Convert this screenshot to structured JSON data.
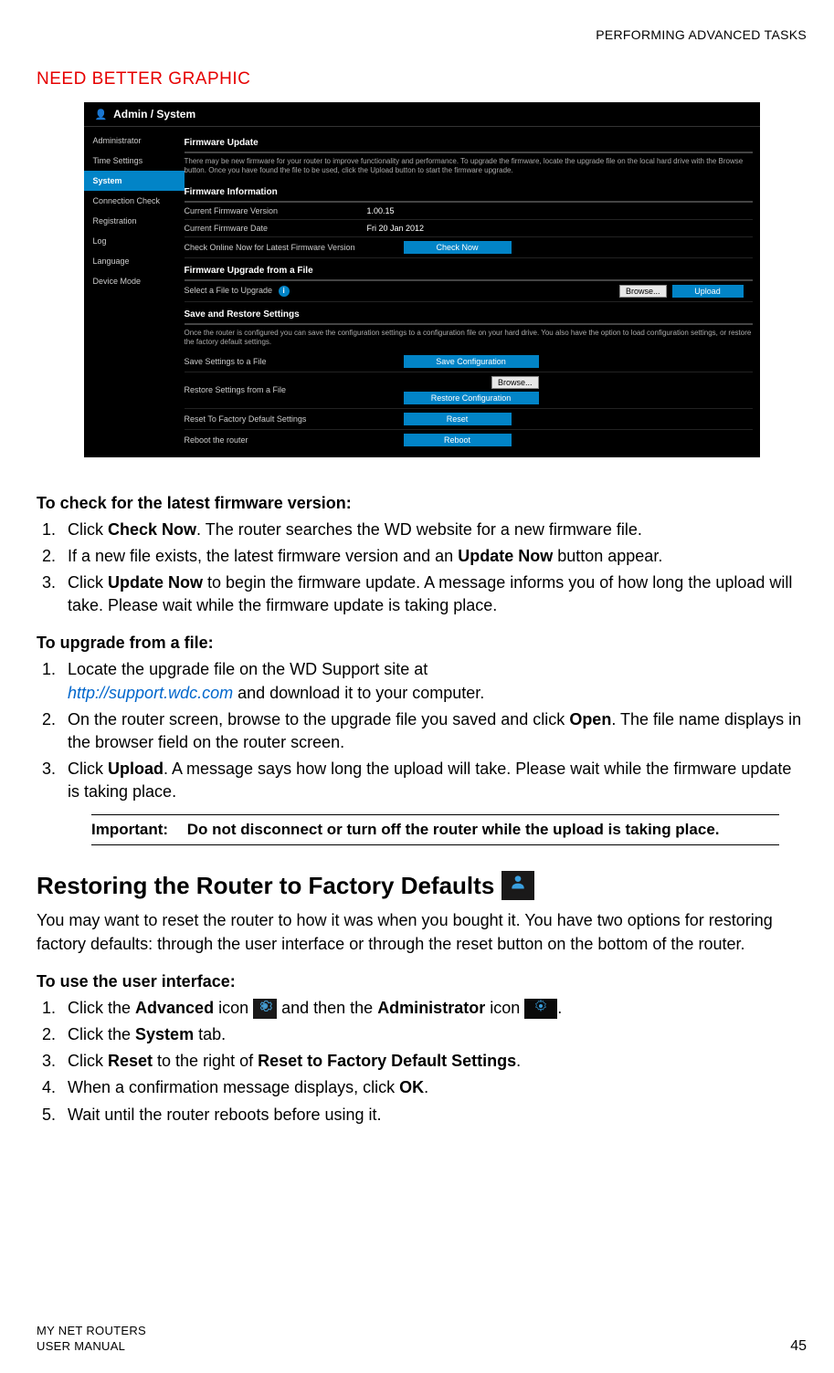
{
  "header": {
    "running": "PERFORMING ADVANCED TASKS"
  },
  "annotation": "NEED BETTER GRAPHIC",
  "screenshot": {
    "breadcrumb": "Admin / System",
    "sidebar": [
      {
        "label": "Administrator",
        "active": false
      },
      {
        "label": "Time Settings",
        "active": false
      },
      {
        "label": "System",
        "active": true
      },
      {
        "label": "Connection Check",
        "active": false
      },
      {
        "label": "Registration",
        "active": false
      },
      {
        "label": "Log",
        "active": false
      },
      {
        "label": "Language",
        "active": false
      },
      {
        "label": "Device Mode",
        "active": false
      }
    ],
    "firmware_update": {
      "title": "Firmware Update",
      "desc": "There may be new firmware for your router to improve functionality and performance.\nTo upgrade the firmware, locate the upgrade file on the local hard drive with the Browse button. Once you have found the file to be used, click the Upload button to start the firmware upgrade."
    },
    "firmware_info": {
      "title": "Firmware Information",
      "version_label": "Current Firmware Version",
      "version_value": "1.00.15",
      "date_label": "Current Firmware Date",
      "date_value": "Fri 20 Jan 2012",
      "check_label": "Check Online Now for Latest Firmware Version",
      "check_btn": "Check Now"
    },
    "firmware_upgrade": {
      "title": "Firmware Upgrade from a File",
      "select_label": "Select a File to Upgrade",
      "browse_btn": "Browse...",
      "upload_btn": "Upload"
    },
    "save_restore": {
      "title": "Save and Restore Settings",
      "desc": "Once the router is configured you can save the configuration settings to a configuration file on your hard drive. You also have the option to load configuration settings, or restore the factory default settings.",
      "save_label": "Save Settings to a File",
      "save_btn": "Save Configuration",
      "restore_label": "Restore Settings from a File",
      "restore_browse": "Browse...",
      "restore_btn": "Restore Configuration",
      "reset_label": "Reset To Factory Default Settings",
      "reset_btn": "Reset",
      "reboot_label": "Reboot the router",
      "reboot_btn": "Reboot"
    }
  },
  "body": {
    "h1": "To check for the latest firmware version:",
    "list1": {
      "i1a": "Click ",
      "i1b": "Check Now",
      "i1c": ". The router searches the WD website for a new firmware file.",
      "i2a": "If a new file exists, the latest firmware version and an ",
      "i2b": "Update Now",
      "i2c": " button appear.",
      "i3a": "Click ",
      "i3b": "Update Now",
      "i3c": " to begin the firmware update. A message informs you of how long the upload will take. Please wait while the firmware update is taking place."
    },
    "h2": "To upgrade from a file:",
    "list2": {
      "i1a": "Locate the upgrade file on the WD Support site at ",
      "i1link": "http://support.wdc.com",
      "i1b": " and download it to your computer.",
      "i2a": "On the router screen, browse to the upgrade file you saved and click ",
      "i2b": "Open",
      "i2c": ". The file name displays in the browser field on the router screen.",
      "i3a": "Click ",
      "i3b": "Upload",
      "i3c": ". A message says how long the upload will take. Please wait while the firmware update is taking place."
    },
    "important": {
      "label": "Important:",
      "text": "Do not disconnect or turn off the router while the upload is taking place."
    },
    "restoring_heading": "Restoring the Router to Factory Defaults",
    "restoring_para": "You may want to reset the router to how it was when you bought it. You have two options for restoring factory defaults: through the user interface or through the reset button on the bottom of the router.",
    "h3": "To use the user interface:",
    "list3": {
      "i1a": "Click the ",
      "i1b": "Advanced",
      "i1c": " icon ",
      "i1d": " and then the ",
      "i1e": "Administrator",
      "i1f": " icon ",
      "i1g": ".",
      "i2a": "Click the ",
      "i2b": "System",
      "i2c": " tab.",
      "i3a": "Click ",
      "i3b": "Reset",
      "i3c": " to the right of ",
      "i3d": "Reset to Factory Default Settings",
      "i3e": ".",
      "i4a": "When a confirmation message displays, click ",
      "i4b": "OK",
      "i4c": ".",
      "i5": "Wait until the router reboots before using it."
    }
  },
  "footer": {
    "left1": "MY NET ROUTERS",
    "left2": "USER MANUAL",
    "page": "45"
  }
}
